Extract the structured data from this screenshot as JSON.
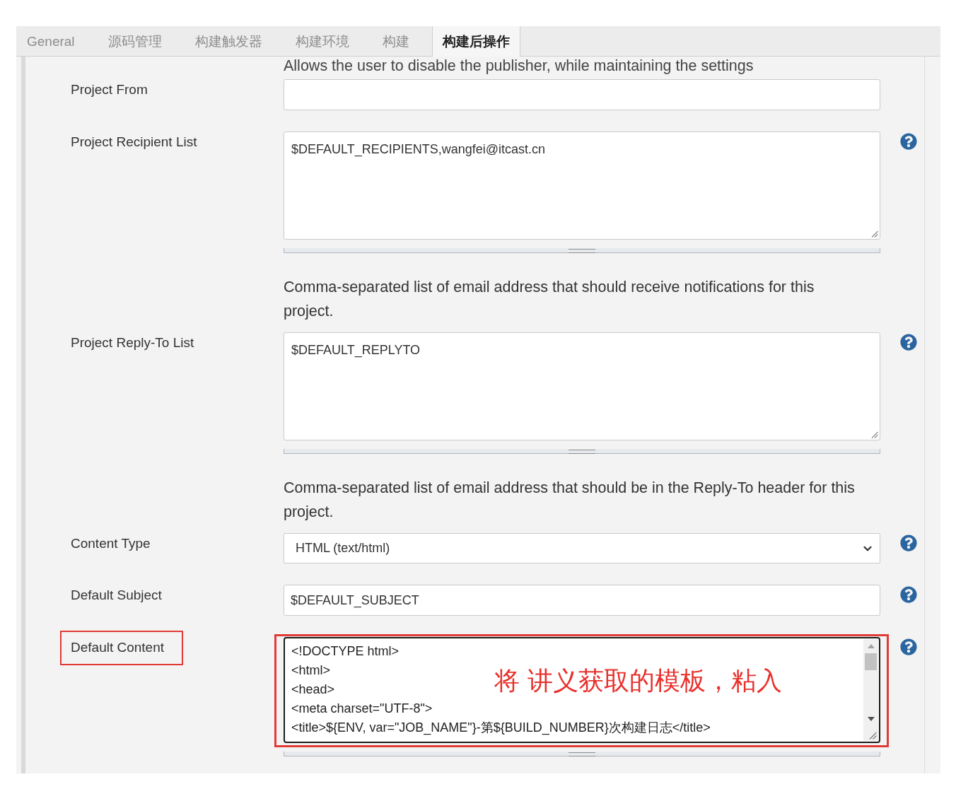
{
  "tabs": [
    {
      "label": "General",
      "selected": false
    },
    {
      "label": "源码管理",
      "selected": false
    },
    {
      "label": "构建触发器",
      "selected": false
    },
    {
      "label": "构建环境",
      "selected": false
    },
    {
      "label": "构建",
      "selected": false
    },
    {
      "label": "构建后操作",
      "selected": true
    }
  ],
  "notice": "Allows the user to disable the publisher, while maintaining the settings",
  "fields": [
    {
      "kind": "input",
      "label": "Project From",
      "help": false,
      "highlighted": false
    },
    {
      "kind": "textarea",
      "label": "Project Recipient List",
      "value": "$DEFAULT_RECIPIENTS,wangfei@itcast.cn",
      "help": true,
      "highlighted": false,
      "description": "Comma-separated list of email address that should receive notifications for this project."
    },
    {
      "kind": "textarea",
      "label": "Project Reply-To List",
      "value": "$DEFAULT_REPLYTO",
      "help": true,
      "highlighted": false,
      "description": "Comma-separated list of email address that should be in the Reply-To header for this project."
    },
    {
      "kind": "select",
      "label": "Content Type",
      "value": "HTML (text/html)",
      "help": true,
      "highlighted": false
    },
    {
      "kind": "input",
      "label": "Default Subject",
      "value": "$DEFAULT_SUBJECT",
      "help": true,
      "highlighted": false
    },
    {
      "kind": "editor",
      "label": "Default Content",
      "lines": [
        "<!DOCTYPE html>",
        "<html>",
        "<head>",
        "<meta charset=\"UTF-8\">",
        "<title>${ENV, var=\"JOB_NAME\"}-第${BUILD_NUMBER}次构建日志</title>"
      ],
      "help": true,
      "highlighted": true,
      "annotation": "将 讲义获取的模板，粘入"
    }
  ]
}
